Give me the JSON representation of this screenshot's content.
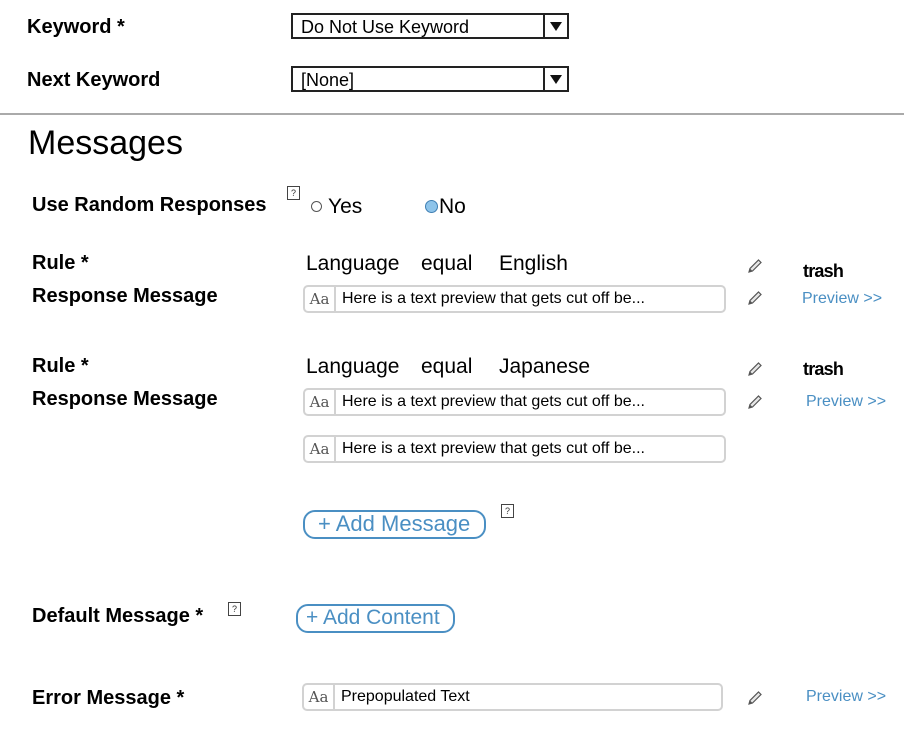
{
  "keyword": {
    "label": "Keyword *",
    "selected": "Do Not Use Keyword"
  },
  "next_keyword": {
    "label": "Next Keyword",
    "selected": "[None]"
  },
  "messages": {
    "heading": "Messages",
    "random_label": "Use Random Responses",
    "help_glyph": "?",
    "yes_label": "Yes",
    "no_label": "No",
    "selected": "No"
  },
  "rules": [
    {
      "rule_label": "Rule *",
      "response_label": "Response Message",
      "field": "Language",
      "operator": "equal",
      "value": "English",
      "delete_label": "trash",
      "responses": [
        "Here is a text preview that gets cut off be..."
      ],
      "preview_label": "Preview >>"
    },
    {
      "rule_label": "Rule *",
      "response_label": "Response Message",
      "field": "Language",
      "operator": "equal",
      "value": "Japanese",
      "delete_label": "trash",
      "responses": [
        "Here is a text preview that gets cut off be...",
        "Here is a text preview that gets cut off be..."
      ],
      "preview_label": "Preview >>"
    }
  ],
  "add_message_label": "+ Add Message",
  "default_message": {
    "label": "Default Message *",
    "add_content_label": "+  Add Content"
  },
  "error_message": {
    "label": "Error Message *",
    "value": "Prepopulated Text",
    "preview_label": "Preview >>"
  },
  "text_type_glyph": "Aa",
  "icons": {
    "edit": "pencil-icon",
    "help": "help-icon",
    "text": "text-format-icon"
  },
  "colors": {
    "link": "#4a8fc3",
    "radio_selected": "#8ec4ea",
    "field_border": "#d2d2d2"
  }
}
